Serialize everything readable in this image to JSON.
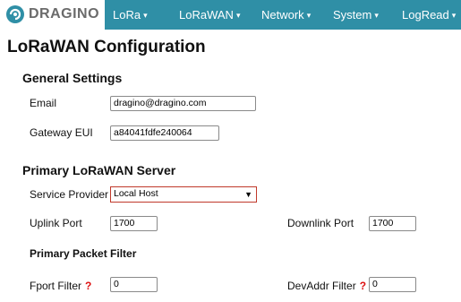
{
  "brand": {
    "name": "DRAGINO",
    "icon": "dragino-logo-icon"
  },
  "nav": {
    "items": [
      {
        "label": "LoRa",
        "icon": "caret-down-icon"
      },
      {
        "label": "LoRaWAN",
        "icon": "caret-down-icon"
      },
      {
        "label": "Network",
        "icon": "caret-down-icon"
      },
      {
        "label": "System",
        "icon": "caret-down-icon"
      },
      {
        "label": "LogRead",
        "icon": "caret-down-icon"
      }
    ],
    "caret": "▾",
    "background": "#2f8fa6"
  },
  "page": {
    "title": "LoRaWAN Configuration"
  },
  "general": {
    "heading": "General Settings",
    "email_label": "Email",
    "email_value": "dragino@dragino.com",
    "eui_label": "Gateway EUI",
    "eui_value": "a84041fdfe240064"
  },
  "server": {
    "heading": "Primary LoRaWAN Server",
    "provider_label": "Service Provider",
    "provider_value": "Local Host",
    "uplink_label": "Uplink Port",
    "uplink_value": "1700",
    "downlink_label": "Downlink Port",
    "downlink_value": "1700"
  },
  "filter": {
    "heading": "Primary Packet Filter",
    "fport_label": "Fport Filter",
    "fport_value": "0",
    "devaddr_label": "DevAddr Filter",
    "devaddr_value": "0",
    "help_glyph": "?",
    "help_icon": "help-question-icon"
  },
  "colors": {
    "accent": "#2f8fa6",
    "select_border": "#c0392b",
    "help": "#dd1111"
  }
}
